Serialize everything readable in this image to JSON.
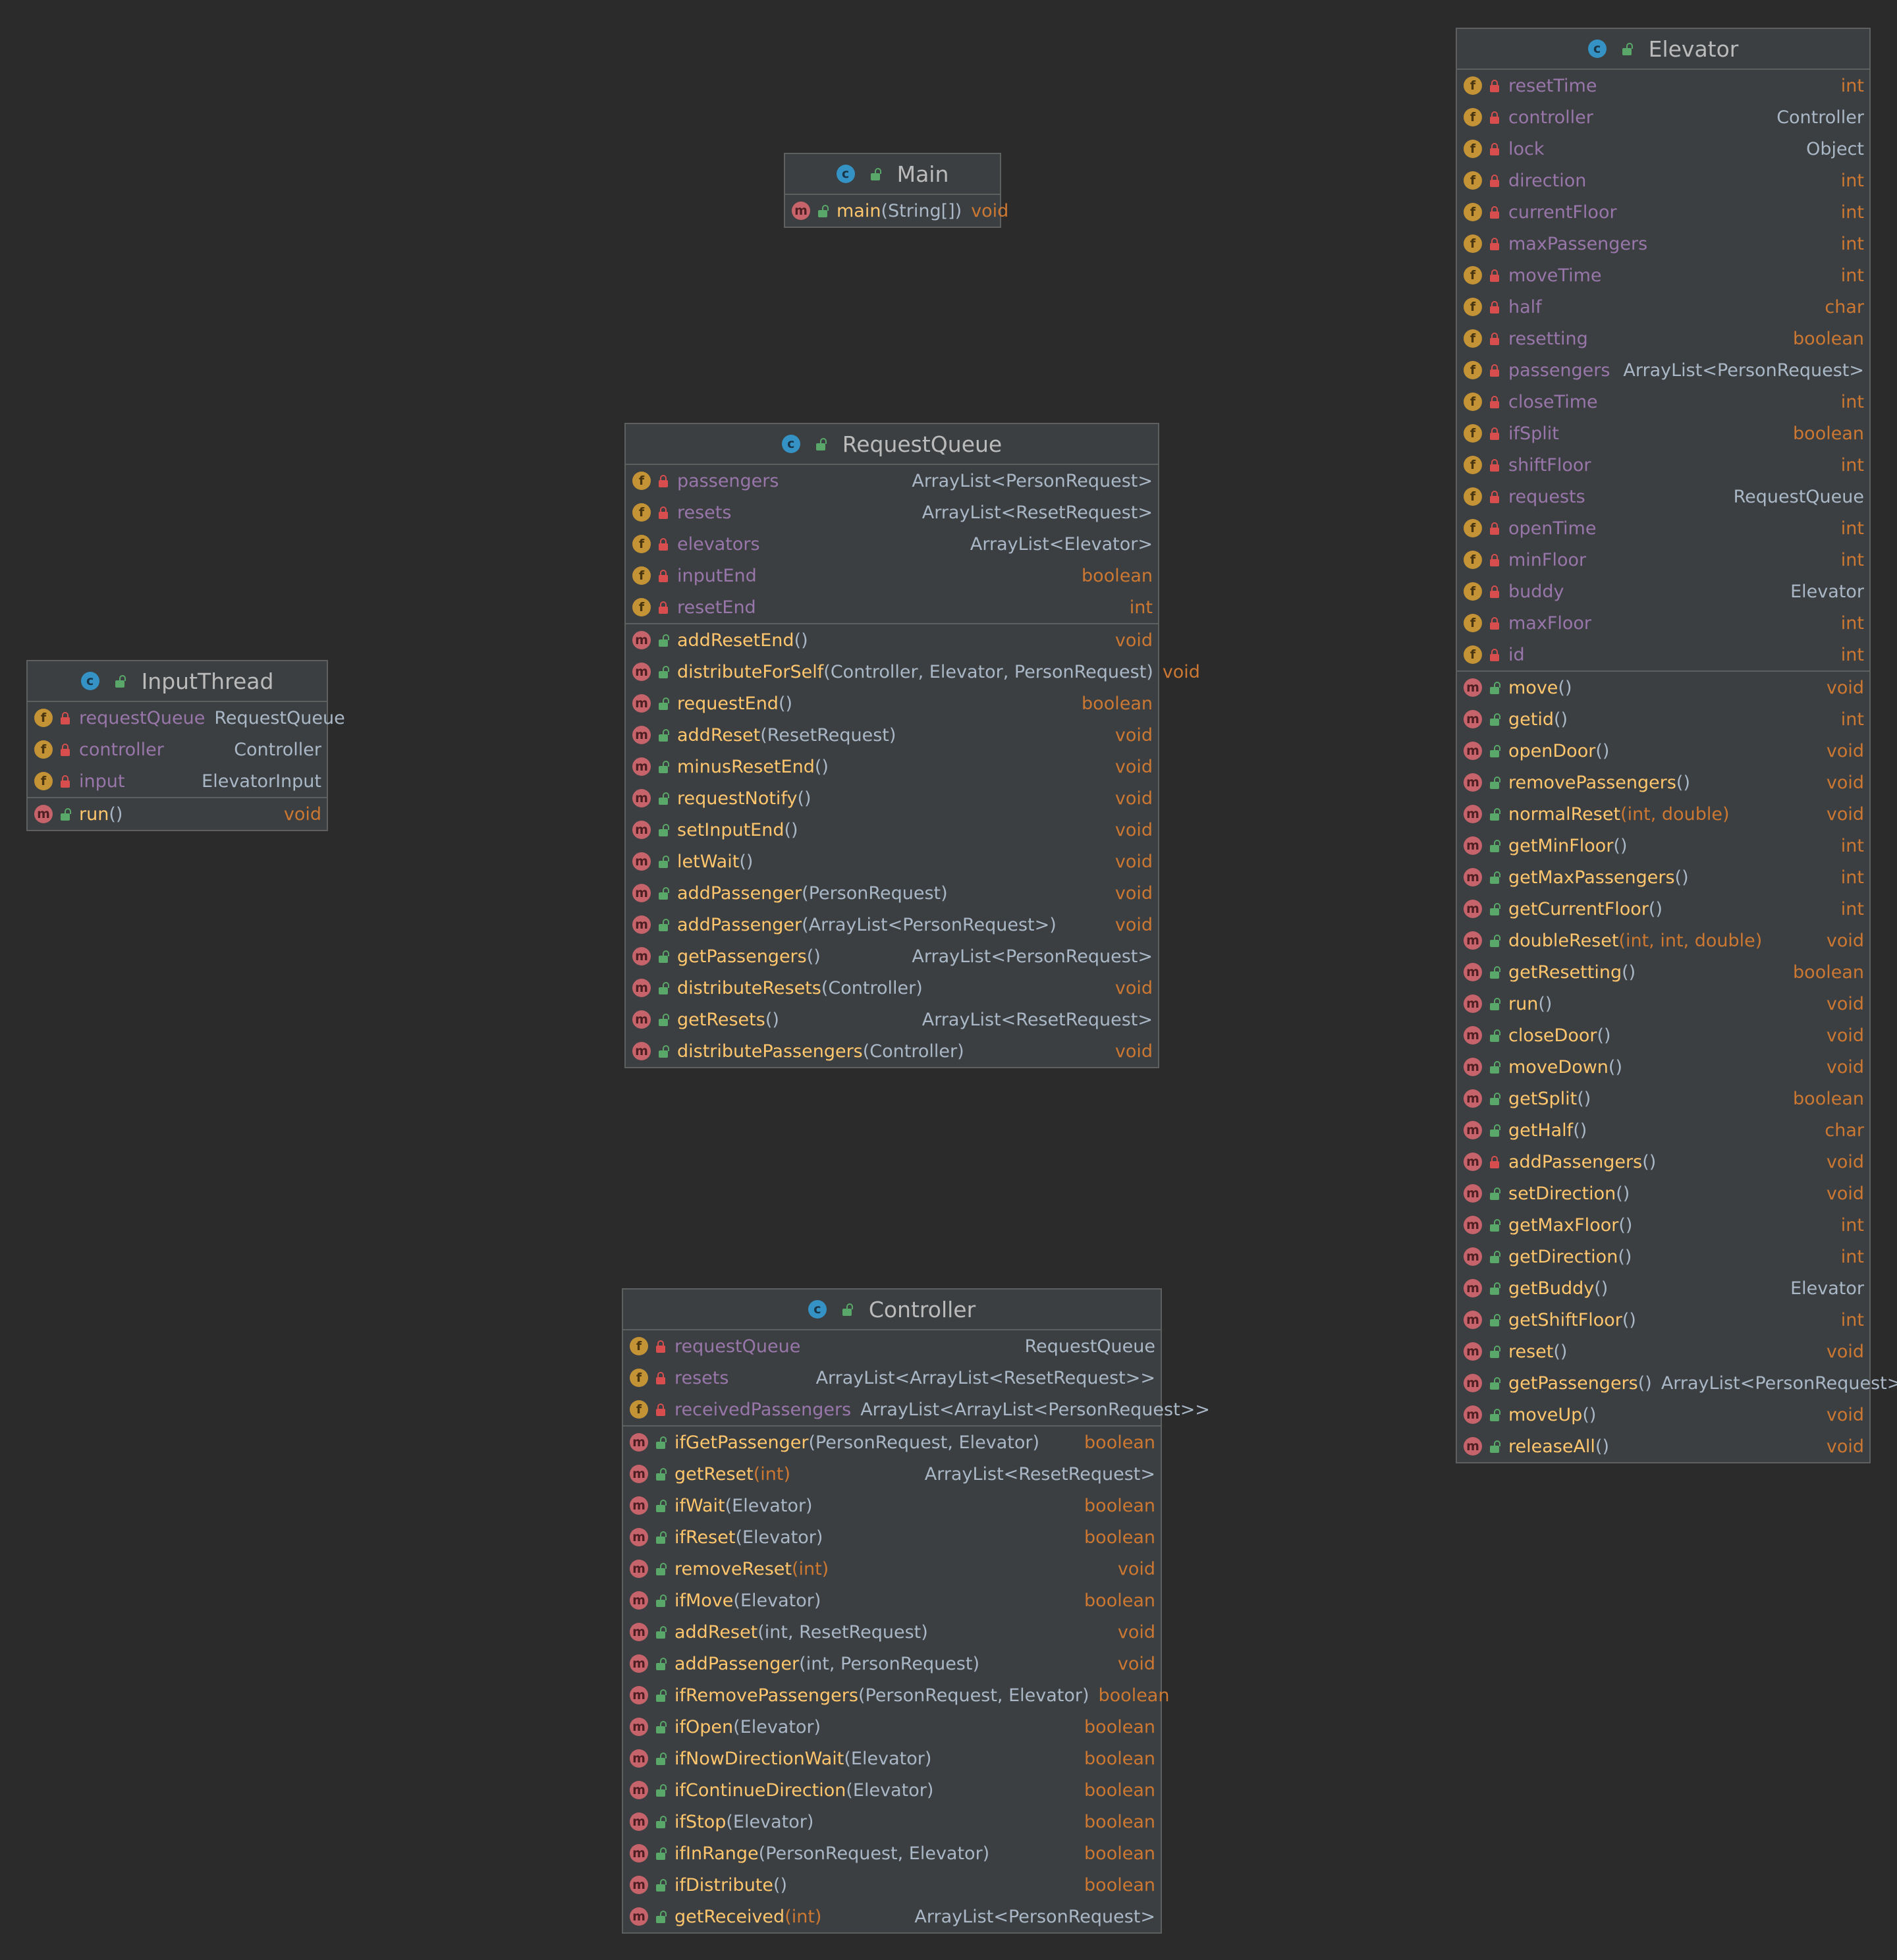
{
  "classes": {
    "main": {
      "name": "Main",
      "fields": [],
      "methods": [
        {
          "name": "main",
          "params": "(String[])",
          "params_primitive": false,
          "type": "void",
          "type_primitive": true
        }
      ]
    },
    "request_queue": {
      "name": "RequestQueue",
      "fields": [
        {
          "name": "passengers",
          "type": "ArrayList<PersonRequest>",
          "type_primitive": false
        },
        {
          "name": "resets",
          "type": "ArrayList<ResetRequest>",
          "type_primitive": false
        },
        {
          "name": "elevators",
          "type": "ArrayList<Elevator>",
          "type_primitive": false
        },
        {
          "name": "inputEnd",
          "type": "boolean",
          "type_primitive": true
        },
        {
          "name": "resetEnd",
          "type": "int",
          "type_primitive": true
        }
      ],
      "methods": [
        {
          "name": "addResetEnd",
          "params": "()",
          "params_primitive": false,
          "type": "void",
          "type_primitive": true
        },
        {
          "name": "distributeForSelf",
          "params": "(Controller, Elevator, PersonRequest)",
          "params_primitive": false,
          "type": "void",
          "type_primitive": true
        },
        {
          "name": "requestEnd",
          "params": "()",
          "params_primitive": false,
          "type": "boolean",
          "type_primitive": true
        },
        {
          "name": "addReset",
          "params": "(ResetRequest)",
          "params_primitive": false,
          "type": "void",
          "type_primitive": true
        },
        {
          "name": "minusResetEnd",
          "params": "()",
          "params_primitive": false,
          "type": "void",
          "type_primitive": true
        },
        {
          "name": "requestNotify",
          "params": "()",
          "params_primitive": false,
          "type": "void",
          "type_primitive": true
        },
        {
          "name": "setInputEnd",
          "params": "()",
          "params_primitive": false,
          "type": "void",
          "type_primitive": true
        },
        {
          "name": "letWait",
          "params": "()",
          "params_primitive": false,
          "type": "void",
          "type_primitive": true
        },
        {
          "name": "addPassenger",
          "params": "(PersonRequest)",
          "params_primitive": false,
          "type": "void",
          "type_primitive": true
        },
        {
          "name": "addPassenger",
          "params": "(ArrayList<PersonRequest>)",
          "params_primitive": false,
          "type": "void",
          "type_primitive": true
        },
        {
          "name": "getPassengers",
          "params": "()",
          "params_primitive": false,
          "type": "ArrayList<PersonRequest>",
          "type_primitive": false
        },
        {
          "name": "distributeResets",
          "params": "(Controller)",
          "params_primitive": false,
          "type": "void",
          "type_primitive": true
        },
        {
          "name": "getResets",
          "params": "()",
          "params_primitive": false,
          "type": "ArrayList<ResetRequest>",
          "type_primitive": false
        },
        {
          "name": "distributePassengers",
          "params": "(Controller)",
          "params_primitive": false,
          "type": "void",
          "type_primitive": true
        }
      ]
    },
    "input_thread": {
      "name": "InputThread",
      "fields": [
        {
          "name": "requestQueue",
          "type": "RequestQueue",
          "type_primitive": false
        },
        {
          "name": "controller",
          "type": "Controller",
          "type_primitive": false
        },
        {
          "name": "input",
          "type": "ElevatorInput",
          "type_primitive": false
        }
      ],
      "methods": [
        {
          "name": "run",
          "params": "()",
          "params_primitive": false,
          "type": "void",
          "type_primitive": true
        }
      ]
    },
    "controller": {
      "name": "Controller",
      "fields": [
        {
          "name": "requestQueue",
          "type": "RequestQueue",
          "type_primitive": false
        },
        {
          "name": "resets",
          "type": "ArrayList<ArrayList<ResetRequest>>",
          "type_primitive": false
        },
        {
          "name": "receivedPassengers",
          "type": "ArrayList<ArrayList<PersonRequest>>",
          "type_primitive": false
        }
      ],
      "methods": [
        {
          "name": "ifGetPassenger",
          "params": "(PersonRequest, Elevator)",
          "params_primitive": false,
          "type": "boolean",
          "type_primitive": true
        },
        {
          "name": "getReset",
          "params": "(int)",
          "params_primitive": true,
          "type": "ArrayList<ResetRequest>",
          "type_primitive": false
        },
        {
          "name": "ifWait",
          "params": "(Elevator)",
          "params_primitive": false,
          "type": "boolean",
          "type_primitive": true
        },
        {
          "name": "ifReset",
          "params": "(Elevator)",
          "params_primitive": false,
          "type": "boolean",
          "type_primitive": true
        },
        {
          "name": "removeReset",
          "params": "(int)",
          "params_primitive": true,
          "type": "void",
          "type_primitive": true
        },
        {
          "name": "ifMove",
          "params": "(Elevator)",
          "params_primitive": false,
          "type": "boolean",
          "type_primitive": true
        },
        {
          "name": "addReset",
          "params": "(int, ResetRequest)",
          "params_primitive": false,
          "type": "void",
          "type_primitive": true
        },
        {
          "name": "addPassenger",
          "params": "(int, PersonRequest)",
          "params_primitive": false,
          "type": "void",
          "type_primitive": true
        },
        {
          "name": "ifRemovePassengers",
          "params": "(PersonRequest, Elevator)",
          "params_primitive": false,
          "type": "boolean",
          "type_primitive": true
        },
        {
          "name": "ifOpen",
          "params": "(Elevator)",
          "params_primitive": false,
          "type": "boolean",
          "type_primitive": true
        },
        {
          "name": "ifNowDirectionWait",
          "params": "(Elevator)",
          "params_primitive": false,
          "type": "boolean",
          "type_primitive": true
        },
        {
          "name": "ifContinueDirection",
          "params": "(Elevator)",
          "params_primitive": false,
          "type": "boolean",
          "type_primitive": true
        },
        {
          "name": "ifStop",
          "params": "(Elevator)",
          "params_primitive": false,
          "type": "boolean",
          "type_primitive": true
        },
        {
          "name": "ifInRange",
          "params": "(PersonRequest, Elevator)",
          "params_primitive": false,
          "type": "boolean",
          "type_primitive": true
        },
        {
          "name": "ifDistribute",
          "params": "()",
          "params_primitive": false,
          "type": "boolean",
          "type_primitive": true
        },
        {
          "name": "getReceived",
          "params": "(int)",
          "params_primitive": true,
          "type": "ArrayList<PersonRequest>",
          "type_primitive": false
        }
      ]
    },
    "elevator": {
      "name": "Elevator",
      "fields": [
        {
          "name": "resetTime",
          "type": "int",
          "type_primitive": true
        },
        {
          "name": "controller",
          "type": "Controller",
          "type_primitive": false
        },
        {
          "name": "lock",
          "type": "Object",
          "type_primitive": false
        },
        {
          "name": "direction",
          "type": "int",
          "type_primitive": true
        },
        {
          "name": "currentFloor",
          "type": "int",
          "type_primitive": true
        },
        {
          "name": "maxPassengers",
          "type": "int",
          "type_primitive": true
        },
        {
          "name": "moveTime",
          "type": "int",
          "type_primitive": true
        },
        {
          "name": "half",
          "type": "char",
          "type_primitive": true
        },
        {
          "name": "resetting",
          "type": "boolean",
          "type_primitive": true
        },
        {
          "name": "passengers",
          "type": "ArrayList<PersonRequest>",
          "type_primitive": false
        },
        {
          "name": "closeTime",
          "type": "int",
          "type_primitive": true
        },
        {
          "name": "ifSplit",
          "type": "boolean",
          "type_primitive": true
        },
        {
          "name": "shiftFloor",
          "type": "int",
          "type_primitive": true
        },
        {
          "name": "requests",
          "type": "RequestQueue",
          "type_primitive": false
        },
        {
          "name": "openTime",
          "type": "int",
          "type_primitive": true
        },
        {
          "name": "minFloor",
          "type": "int",
          "type_primitive": true
        },
        {
          "name": "buddy",
          "type": "Elevator",
          "type_primitive": false
        },
        {
          "name": "maxFloor",
          "type": "int",
          "type_primitive": true
        },
        {
          "name": "id",
          "type": "int",
          "type_primitive": true
        }
      ],
      "methods": [
        {
          "name": "move",
          "params": "()",
          "params_primitive": false,
          "type": "void",
          "type_primitive": true,
          "private": false
        },
        {
          "name": "getid",
          "params": "()",
          "params_primitive": false,
          "type": "int",
          "type_primitive": true,
          "private": false
        },
        {
          "name": "openDoor",
          "params": "()",
          "params_primitive": false,
          "type": "void",
          "type_primitive": true,
          "private": false
        },
        {
          "name": "removePassengers",
          "params": "()",
          "params_primitive": false,
          "type": "void",
          "type_primitive": true,
          "private": false
        },
        {
          "name": "normalReset",
          "params": "(int, double)",
          "params_primitive": true,
          "type": "void",
          "type_primitive": true,
          "private": false
        },
        {
          "name": "getMinFloor",
          "params": "()",
          "params_primitive": false,
          "type": "int",
          "type_primitive": true,
          "private": false
        },
        {
          "name": "getMaxPassengers",
          "params": "()",
          "params_primitive": false,
          "type": "int",
          "type_primitive": true,
          "private": false
        },
        {
          "name": "getCurrentFloor",
          "params": "()",
          "params_primitive": false,
          "type": "int",
          "type_primitive": true,
          "private": false
        },
        {
          "name": "doubleReset",
          "params": "(int, int, double)",
          "params_primitive": true,
          "type": "void",
          "type_primitive": true,
          "private": false
        },
        {
          "name": "getResetting",
          "params": "()",
          "params_primitive": false,
          "type": "boolean",
          "type_primitive": true,
          "private": false
        },
        {
          "name": "run",
          "params": "()",
          "params_primitive": false,
          "type": "void",
          "type_primitive": true,
          "private": false
        },
        {
          "name": "closeDoor",
          "params": "()",
          "params_primitive": false,
          "type": "void",
          "type_primitive": true,
          "private": false
        },
        {
          "name": "moveDown",
          "params": "()",
          "params_primitive": false,
          "type": "void",
          "type_primitive": true,
          "private": false
        },
        {
          "name": "getSplit",
          "params": "()",
          "params_primitive": false,
          "type": "boolean",
          "type_primitive": true,
          "private": false
        },
        {
          "name": "getHalf",
          "params": "()",
          "params_primitive": false,
          "type": "char",
          "type_primitive": true,
          "private": false
        },
        {
          "name": "addPassengers",
          "params": "()",
          "params_primitive": false,
          "type": "void",
          "type_primitive": true,
          "private": true
        },
        {
          "name": "setDirection",
          "params": "()",
          "params_primitive": false,
          "type": "void",
          "type_primitive": true,
          "private": false
        },
        {
          "name": "getMaxFloor",
          "params": "()",
          "params_primitive": false,
          "type": "int",
          "type_primitive": true,
          "private": false
        },
        {
          "name": "getDirection",
          "params": "()",
          "params_primitive": false,
          "type": "int",
          "type_primitive": true,
          "private": false
        },
        {
          "name": "getBuddy",
          "params": "()",
          "params_primitive": false,
          "type": "Elevator",
          "type_primitive": false,
          "private": false
        },
        {
          "name": "getShiftFloor",
          "params": "()",
          "params_primitive": false,
          "type": "int",
          "type_primitive": true,
          "private": false
        },
        {
          "name": "reset",
          "params": "()",
          "params_primitive": false,
          "type": "void",
          "type_primitive": true,
          "private": false
        },
        {
          "name": "getPassengers",
          "params": "()",
          "params_primitive": false,
          "type": "ArrayList<PersonRequest>",
          "type_primitive": false,
          "private": false
        },
        {
          "name": "moveUp",
          "params": "()",
          "params_primitive": false,
          "type": "void",
          "type_primitive": true,
          "private": false
        },
        {
          "name": "releaseAll",
          "params": "()",
          "params_primitive": false,
          "type": "void",
          "type_primitive": true,
          "private": false
        }
      ]
    }
  }
}
